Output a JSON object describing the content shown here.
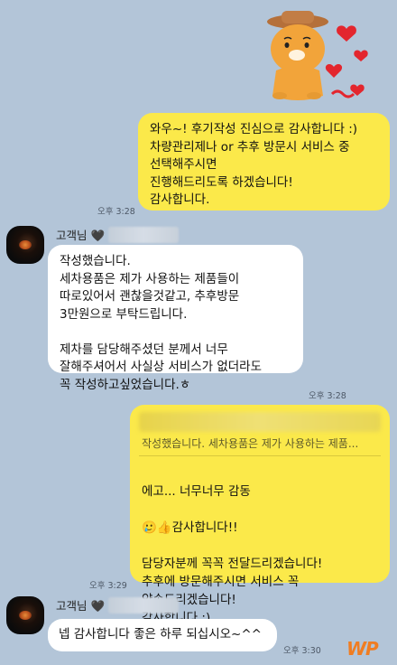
{
  "messages": {
    "m1": {
      "text": "와우~! 후기작성 진심으로 감사합니다 :)\n차량관리제나 or 추후 방문시 서비스 중\n선택해주시면\n진행해드리도록 하겠습니다!\n감사합니다.",
      "time": "오후 3:28"
    },
    "m2": {
      "sender": "고객님 🖤",
      "text": "작성했습니다.\n세차용품은 제가 사용하는 제품들이\n따로있어서 괜찮을것같고, 추후방문\n3만원으로 부탁드립니다.\n\n제차를 담당해주셨던 분께서 너무\n잘해주셔어서 사실상 서비스가 없더라도\n꼭 작성하고싶었습니다.ㅎ",
      "time": "오후 3:28"
    },
    "m3": {
      "quote": "작성했습니다.  세차용품은 제가 사용하는 제품...",
      "emoji": "🥲👍",
      "line1": "에고... 너무너무 감동",
      "line2": "감사합니다!!",
      "rest": "담당자분께 꼭꼭 전달드리겠습니다!\n추후에 방문해주시면 서비스 꼭\n약속드리겠습니다!\n감사합니다 :)",
      "time": "오후 3:29"
    },
    "m4": {
      "sender": "고객님 🖤",
      "text": "넵 감사합니다 좋은 하루 되십시오~^^",
      "time": "오후 3:30"
    }
  },
  "watermark": "WP",
  "colors": {
    "background": "#b3c5d8",
    "my_bubble": "#fbe94a",
    "other_bubble": "#ffffff",
    "watermark": "#f07d22"
  }
}
